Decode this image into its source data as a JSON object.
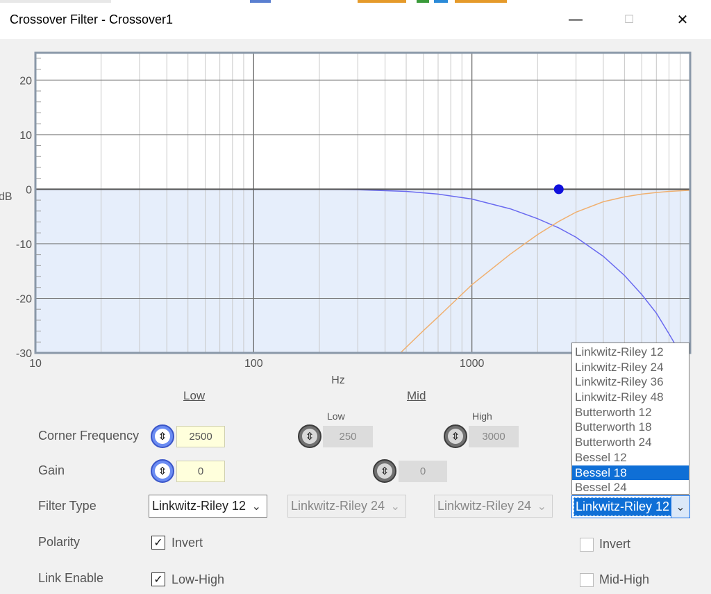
{
  "window": {
    "title": "Crossover Filter - Crossover1",
    "minimize_symbol": "—",
    "maximize_symbol": "☐",
    "close_symbol": "✕"
  },
  "chart_data": {
    "type": "line",
    "x_scale": "log",
    "xlim": [
      10,
      10000
    ],
    "ylim": [
      -30,
      25
    ],
    "x_ticks": [
      10,
      100,
      1000
    ],
    "x_tick_labels": [
      "10",
      "100",
      "1000"
    ],
    "y_ticks": [
      20,
      10,
      0,
      -10,
      -20,
      -30
    ],
    "y_tick_labels": [
      "20",
      "10",
      "0",
      "-10",
      "-20",
      "-30"
    ],
    "xlabel": "Hz",
    "ylabel": "dB",
    "grid": true,
    "fill_color": "#e6eefb",
    "series": [
      {
        "color": "#6a6af0",
        "points": [
          [
            10,
            0
          ],
          [
            100,
            0
          ],
          [
            200,
            0
          ],
          [
            300,
            -0.1
          ],
          [
            500,
            -0.4
          ],
          [
            700,
            -0.9
          ],
          [
            1000,
            -1.8
          ],
          [
            1500,
            -3.6
          ],
          [
            2000,
            -5.4
          ],
          [
            2500,
            -7.1
          ],
          [
            3000,
            -8.8
          ],
          [
            4000,
            -12.3
          ],
          [
            5000,
            -15.8
          ],
          [
            6000,
            -19.3
          ],
          [
            7000,
            -22.7
          ],
          [
            8000,
            -26.5
          ],
          [
            9000,
            -30
          ]
        ]
      },
      {
        "color": "#f0b070",
        "points": [
          [
            470,
            -30
          ],
          [
            600,
            -25.9
          ],
          [
            700,
            -23.4
          ],
          [
            1000,
            -17.5
          ],
          [
            1500,
            -11.9
          ],
          [
            2000,
            -8.3
          ],
          [
            2500,
            -5.9
          ],
          [
            3000,
            -4.2
          ],
          [
            4000,
            -2.3
          ],
          [
            5000,
            -1.4
          ],
          [
            6000,
            -0.9
          ],
          [
            7000,
            -0.6
          ],
          [
            8000,
            -0.4
          ],
          [
            10000,
            -0.2
          ]
        ]
      },
      {
        "color": "#555555",
        "points": [
          [
            10,
            0
          ],
          [
            10000,
            0
          ]
        ]
      }
    ],
    "marker": {
      "x": 2500,
      "y": 0,
      "color": "#1010dd"
    }
  },
  "sections": {
    "low": "Low",
    "mid": "Mid",
    "mid_low": "Low",
    "mid_high": "High"
  },
  "rows": {
    "corner_frequency": "Corner Frequency",
    "gain": "Gain",
    "filter_type": "Filter Type",
    "polarity": "Polarity",
    "link_enable": "Link Enable"
  },
  "knob_symbol": "⇳",
  "low": {
    "corner_frequency": "2500",
    "gain": "0",
    "filter_type": "Linkwitz-Riley 12",
    "polarity_checked": true,
    "polarity_label": "Invert",
    "link_checked": true,
    "link_label": "Low-High"
  },
  "mid": {
    "low_frequency": "250",
    "high_frequency": "3000",
    "gain": "0",
    "filter_type_low": "Linkwitz-Riley 24",
    "filter_type_high": "Linkwitz-Riley 24"
  },
  "high": {
    "filter_type": "Linkwitz-Riley 12",
    "polarity_checked": false,
    "polarity_label": "Invert",
    "link_checked": false,
    "link_label": "Mid-High"
  },
  "checkmark": "✓",
  "chevron": "⌄",
  "dropdown": {
    "options": [
      "Linkwitz-Riley 12",
      "Linkwitz-Riley 24",
      "Linkwitz-Riley 36",
      "Linkwitz-Riley 48",
      "Butterworth 12",
      "Butterworth 18",
      "Butterworth 24",
      "Bessel 12",
      "Bessel 18",
      "Bessel 24"
    ],
    "selected_index": 8
  }
}
